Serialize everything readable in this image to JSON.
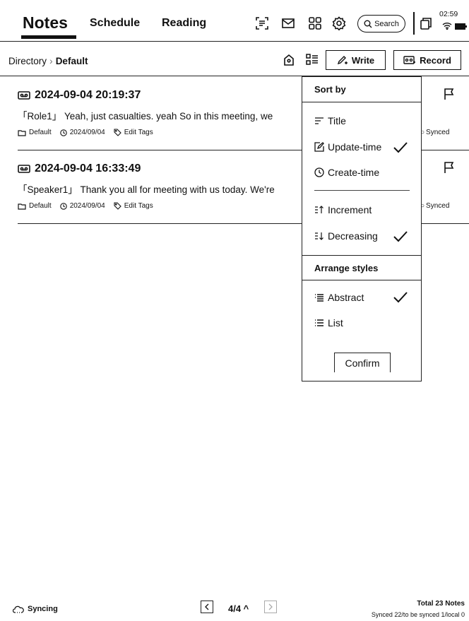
{
  "header": {
    "tabs": [
      {
        "label": "Notes"
      },
      {
        "label": "Schedule"
      },
      {
        "label": "Reading"
      }
    ],
    "search_label": "Search",
    "clock": "02:59",
    "icons": [
      "scan-icon",
      "mail-icon",
      "apps-grid-icon",
      "gear-icon",
      "search-icon",
      "recent-windows-icon",
      "wifi-icon",
      "battery-icon"
    ]
  },
  "subbar": {
    "breadcrumb_root": "Directory",
    "breadcrumb_current": "Default",
    "write_label": "Write",
    "record_label": "Record"
  },
  "notes": [
    {
      "title": "2024-09-04 20:19:37",
      "text": "「Role1」 Yeah, just casualties. yeah So in this meeting, we",
      "folder": "Default",
      "date": "2024/09/04",
      "tags": "Edit Tags",
      "sync": "Synced"
    },
    {
      "title": "2024-09-04 16:33:49",
      "text": "「Speaker1」 Thank you all for meeting with us today. We're",
      "folder": "Default",
      "date": "2024/09/04",
      "tags": "Edit Tags",
      "sync": "Synced"
    }
  ],
  "sort_panel": {
    "sort_heading": "Sort by",
    "options": [
      {
        "label": "Title",
        "checked": false
      },
      {
        "label": "Update-time",
        "checked": true
      },
      {
        "label": "Create-time",
        "checked": false
      }
    ],
    "order": [
      {
        "label": "Increment",
        "checked": false
      },
      {
        "label": "Decreasing",
        "checked": true
      }
    ],
    "arrange_heading": "Arrange styles",
    "styles": [
      {
        "label": "Abstract",
        "checked": true
      },
      {
        "label": "List",
        "checked": false
      }
    ],
    "confirm_label": "Confirm"
  },
  "footer": {
    "sync_status": "Syncing",
    "page": "4/4 ^",
    "total": "Total 23 Notes",
    "synced_stats": "Synced 22/to be synced 1/local 0"
  }
}
